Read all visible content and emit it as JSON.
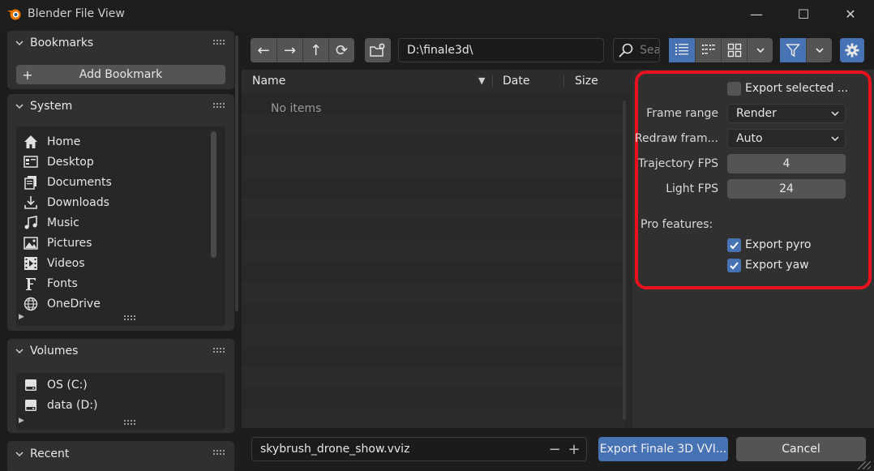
{
  "window": {
    "title": "Blender File View",
    "minimize_glyph": "—",
    "maximize_glyph": "☐",
    "close_glyph": "✕"
  },
  "sidebar": {
    "bookmarks": {
      "header": "Bookmarks",
      "add_button": "Add Bookmark",
      "add_button_glyph": "+"
    },
    "system": {
      "header": "System",
      "items": [
        {
          "label": "Home",
          "icon": "home-icon"
        },
        {
          "label": "Desktop",
          "icon": "desktop-icon"
        },
        {
          "label": "Documents",
          "icon": "documents-icon"
        },
        {
          "label": "Downloads",
          "icon": "downloads-icon"
        },
        {
          "label": "Music",
          "icon": "music-icon"
        },
        {
          "label": "Pictures",
          "icon": "pictures-icon"
        },
        {
          "label": "Videos",
          "icon": "videos-icon"
        },
        {
          "label": "Fonts",
          "icon": "fonts-icon"
        },
        {
          "label": "OneDrive",
          "icon": "globe-icon"
        }
      ]
    },
    "volumes": {
      "header": "Volumes",
      "items": [
        {
          "label": "OS (C:)",
          "icon": "drive-icon"
        },
        {
          "label": "data (D:)",
          "icon": "drive-icon"
        }
      ]
    },
    "recent": {
      "header": "Recent"
    }
  },
  "toolbar": {
    "back_glyph": "←",
    "forward_glyph": "→",
    "parent_glyph": "↑",
    "refresh_glyph": "⟳",
    "path": "D:\\finale3d\\",
    "search_placeholder": "Search",
    "display_modes": [
      "vertical-list-icon",
      "horizontal-list-icon",
      "thumbnails-icon"
    ],
    "active_display_mode": "vertical-list-icon"
  },
  "file_list": {
    "columns": [
      "Name",
      "Date",
      "Size"
    ],
    "sort_glyph": "▼",
    "empty_text": "No items"
  },
  "options": {
    "export_selected": {
      "label": "Export selected ...",
      "checked": false
    },
    "frame_range": {
      "label": "Frame range",
      "value": "Render"
    },
    "redraw_frames": {
      "label": "Redraw fram...",
      "value": "Auto"
    },
    "trajectory_fps": {
      "label": "Trajectory FPS",
      "value": "4"
    },
    "light_fps": {
      "label": "Light FPS",
      "value": "24"
    },
    "pro_features_label": "Pro features:",
    "export_pyro": {
      "label": "Export pyro",
      "checked": true
    },
    "export_yaw": {
      "label": "Export yaw",
      "checked": true
    },
    "highlight_color": "#e8121e"
  },
  "bottom": {
    "filename": "skybrush_drone_show.vviz",
    "decrement_glyph": "−",
    "increment_glyph": "+",
    "export_button": "Export Finale 3D VVI...",
    "cancel_button": "Cancel"
  },
  "colors": {
    "accent": "#4772b3",
    "panel": "#303030",
    "background": "#1d1d1d"
  }
}
